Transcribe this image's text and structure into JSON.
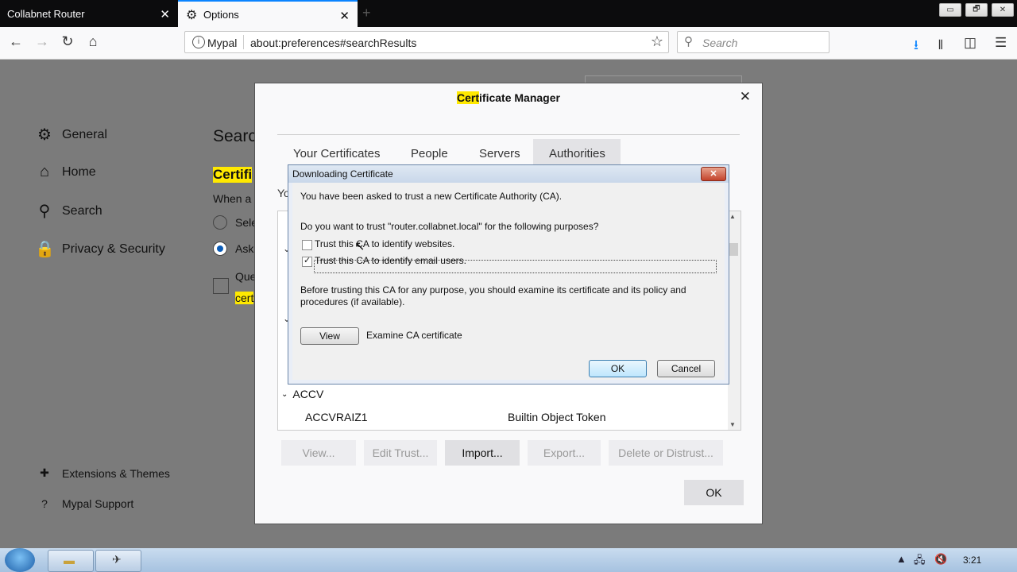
{
  "browser": {
    "tabs": [
      {
        "label": "Collabnet Router",
        "close": "✕"
      },
      {
        "label": "Options",
        "close": "✕"
      }
    ],
    "new_tab": "+",
    "window_controls": [
      "▭",
      "🗗",
      "✕"
    ],
    "url": {
      "site_label": "Mypal",
      "address": "about:preferences#searchResults"
    },
    "search_placeholder": "Search",
    "icons": [
      "back-icon",
      "forward-icon",
      "reload-icon",
      "home-icon",
      "bookmark-star-icon",
      "download-icon",
      "library-icon",
      "sidebar-icon",
      "menu-icon"
    ]
  },
  "prefs": {
    "sidebar": [
      {
        "label": "General",
        "icon": "gear-icon"
      },
      {
        "label": "Home",
        "icon": "home-icon"
      },
      {
        "label": "Search",
        "icon": "search-icon"
      },
      {
        "label": "Privacy & Security",
        "icon": "lock-icon"
      }
    ],
    "sidebar_bottom": [
      {
        "label": "Extensions & Themes",
        "icon": "puzzle-icon"
      },
      {
        "label": "Mypal Support",
        "icon": "help-icon"
      }
    ],
    "main": {
      "heading": "Searc",
      "cert_heading": "Certifi",
      "when": "When a",
      "radio1": "Sele",
      "radio2": "Ask",
      "query": "Que",
      "query2": "cert",
      "you": "Yo"
    }
  },
  "cert_manager": {
    "title_highlight": "Cert",
    "title_rest": "ificate Manager",
    "close": "✕",
    "tabs": [
      "Your Certificates",
      "People",
      "Servers",
      "Authorities"
    ],
    "list": {
      "group": "ACCV",
      "row": {
        "name": "ACCVRAIZ1",
        "token": "Builtin Object Token"
      }
    },
    "buttons": [
      "View...",
      "Edit Trust...",
      "Import...",
      "Export...",
      "Delete or Distrust..."
    ],
    "ok": "OK"
  },
  "download_dialog": {
    "title": "Downloading Certificate",
    "close": "✕",
    "line1": "You have been asked to trust a new Certificate Authority (CA).",
    "question": "Do you want to trust \"router.collabnet.local\" for the following purposes?",
    "options": [
      {
        "label": "Trust this CA to identify websites.",
        "checked": false
      },
      {
        "label": "Trust this CA to identify email users.",
        "checked": true
      }
    ],
    "advice_line1": "Before trusting this CA for any purpose, you should examine its certificate and its policy and",
    "advice_line2": "procedures (if available).",
    "view_button": "View",
    "examine_label": "Examine CA certificate",
    "ok": "OK",
    "cancel": "Cancel"
  },
  "taskbar": {
    "clock": "3:21"
  }
}
